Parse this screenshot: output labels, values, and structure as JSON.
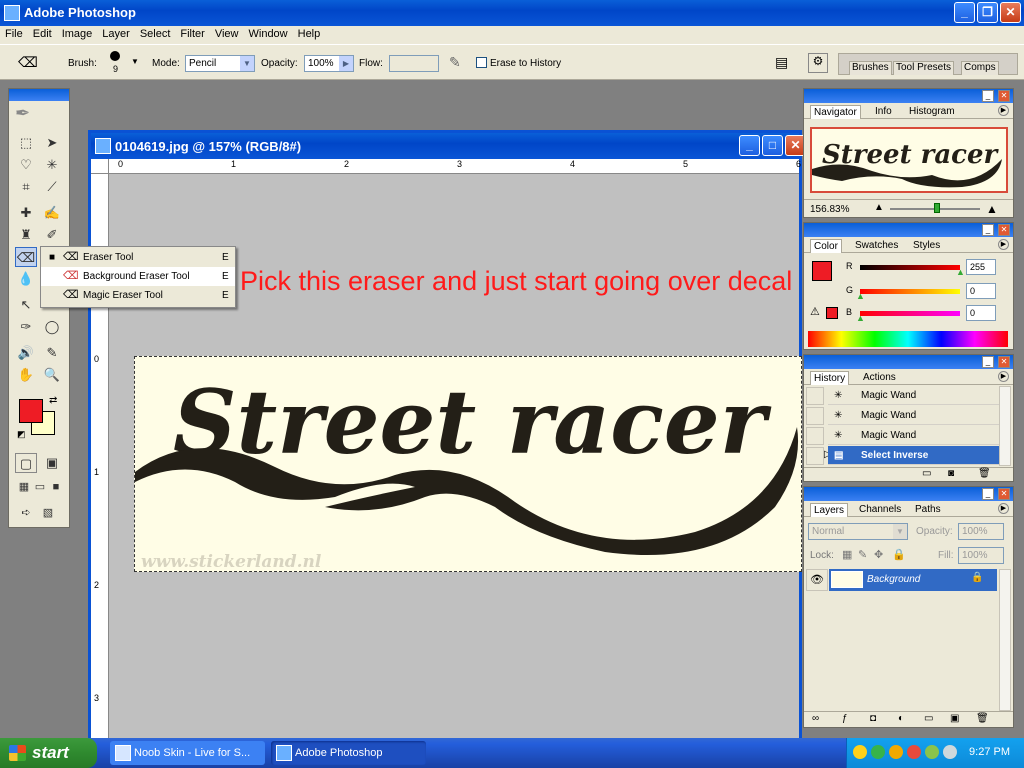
{
  "app": {
    "title": "Adobe Photoshop"
  },
  "menu": [
    "File",
    "Edit",
    "Image",
    "Layer",
    "Select",
    "Filter",
    "View",
    "Window",
    "Help"
  ],
  "options": {
    "brush_label": "Brush:",
    "brush_size": "9",
    "mode_label": "Mode:",
    "mode_value": "Pencil",
    "opacity_label": "Opacity:",
    "opacity_value": "100%",
    "flow_label": "Flow:",
    "erase_history": "Erase to History"
  },
  "well_tabs": [
    "Brushes",
    "Tool Presets",
    "Comps"
  ],
  "flyout": [
    {
      "name": "Eraser Tool",
      "key": "E",
      "icon": "eraser-icon"
    },
    {
      "name": "Background Eraser Tool",
      "key": "E",
      "icon": "background-eraser-icon"
    },
    {
      "name": "Magic Eraser Tool",
      "key": "E",
      "icon": "magic-eraser-icon"
    }
  ],
  "document": {
    "title": "0104619.jpg @ 157% (RGB/8#)",
    "ruler_top": [
      "0",
      "1",
      "2",
      "3",
      "4",
      "5",
      "6"
    ],
    "ruler_left": [
      "0",
      "1",
      "2",
      "3"
    ],
    "decal_text": "Street racer",
    "watermark": "www.stickerland.nl"
  },
  "annotation": "Pick this eraser and just start going over decal",
  "navigator": {
    "tabs": [
      "Navigator",
      "Info",
      "Histogram"
    ],
    "zoom": "156.83%"
  },
  "color": {
    "tabs": [
      "Color",
      "Swatches",
      "Styles"
    ],
    "r_label": "R",
    "g_label": "G",
    "b_label": "B",
    "r": "255",
    "g": "0",
    "b": "0",
    "foreground": "#ee1c25"
  },
  "history": {
    "tabs": [
      "History",
      "Actions"
    ],
    "items": [
      "Magic Wand",
      "Magic Wand",
      "Magic Wand",
      "Select Inverse"
    ]
  },
  "layers": {
    "tabs": [
      "Layers",
      "Channels",
      "Paths"
    ],
    "blend": "Normal",
    "opacity_label": "Opacity:",
    "opacity": "100%",
    "lock_label": "Lock:",
    "fill_label": "Fill:",
    "fill": "100%",
    "layer_name": "Background"
  },
  "taskbar": {
    "start": "start",
    "tasks": [
      "Noob Skin - Live for S...",
      "Adobe Photoshop"
    ],
    "clock": "9:27 PM"
  }
}
